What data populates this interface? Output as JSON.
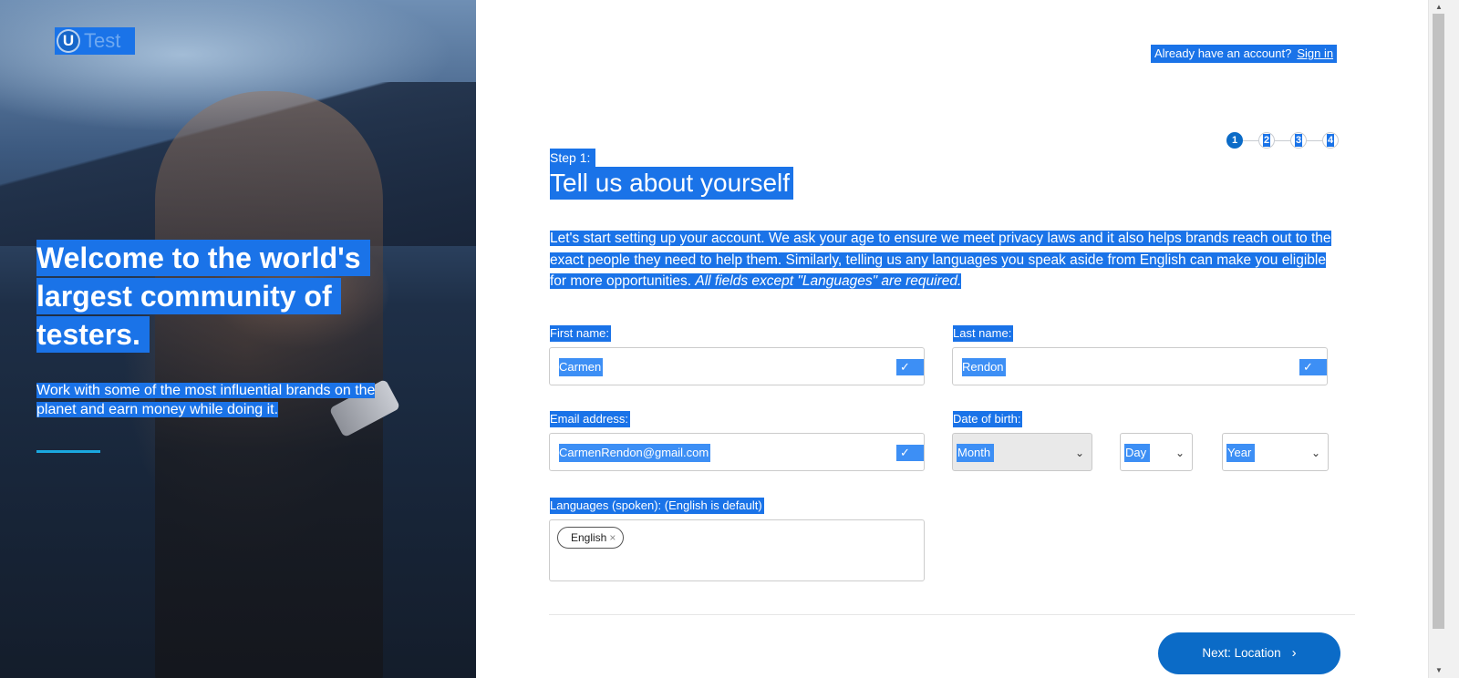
{
  "brand": {
    "logo_letter": "U",
    "logo_text": "Test"
  },
  "hero": {
    "heading_lines": [
      "Welcome to the world's",
      "largest community of",
      "testers."
    ],
    "subtitle_lines": [
      "Work with some of the most influential brands on the",
      "planet and earn money while doing it."
    ]
  },
  "header": {
    "already_text": "Already have an account?",
    "signin_label": "Sign in"
  },
  "steps": [
    "1",
    "2",
    "3",
    "4"
  ],
  "form": {
    "step_label": "Step 1:",
    "title": "Tell us about yourself",
    "intro_lines": [
      "Let's start setting up your account. We ask your age to ensure we meet privacy laws and it also helps brands reach out to the",
      "exact people they need to help them. Similarly, telling us any languages you speak aside from English can make you eligible",
      "for more opportunities. "
    ],
    "intro_italic": "All fields except \"Languages\" are required.",
    "first_name_label": "First name:",
    "first_name_value": "Carmen",
    "last_name_label": "Last name:",
    "last_name_value": "Rendon",
    "email_label": "Email address:",
    "email_value": "CarmenRendon@gmail.com",
    "dob_label": "Date of birth:",
    "dob_month": "Month",
    "dob_day": "Day",
    "dob_year": "Year",
    "languages_label": "Languages (spoken): (English is default)",
    "language_tags": [
      "English"
    ],
    "next_label": "Next: Location"
  },
  "icons": {
    "check": "check-icon",
    "chevron": "chevron-down-icon",
    "next": "chevron-right-icon",
    "remove": "close-icon"
  },
  "colors": {
    "primary": "#0b6bc7",
    "selection": "#1a73e8",
    "accent_line": "#1aa8e0"
  }
}
